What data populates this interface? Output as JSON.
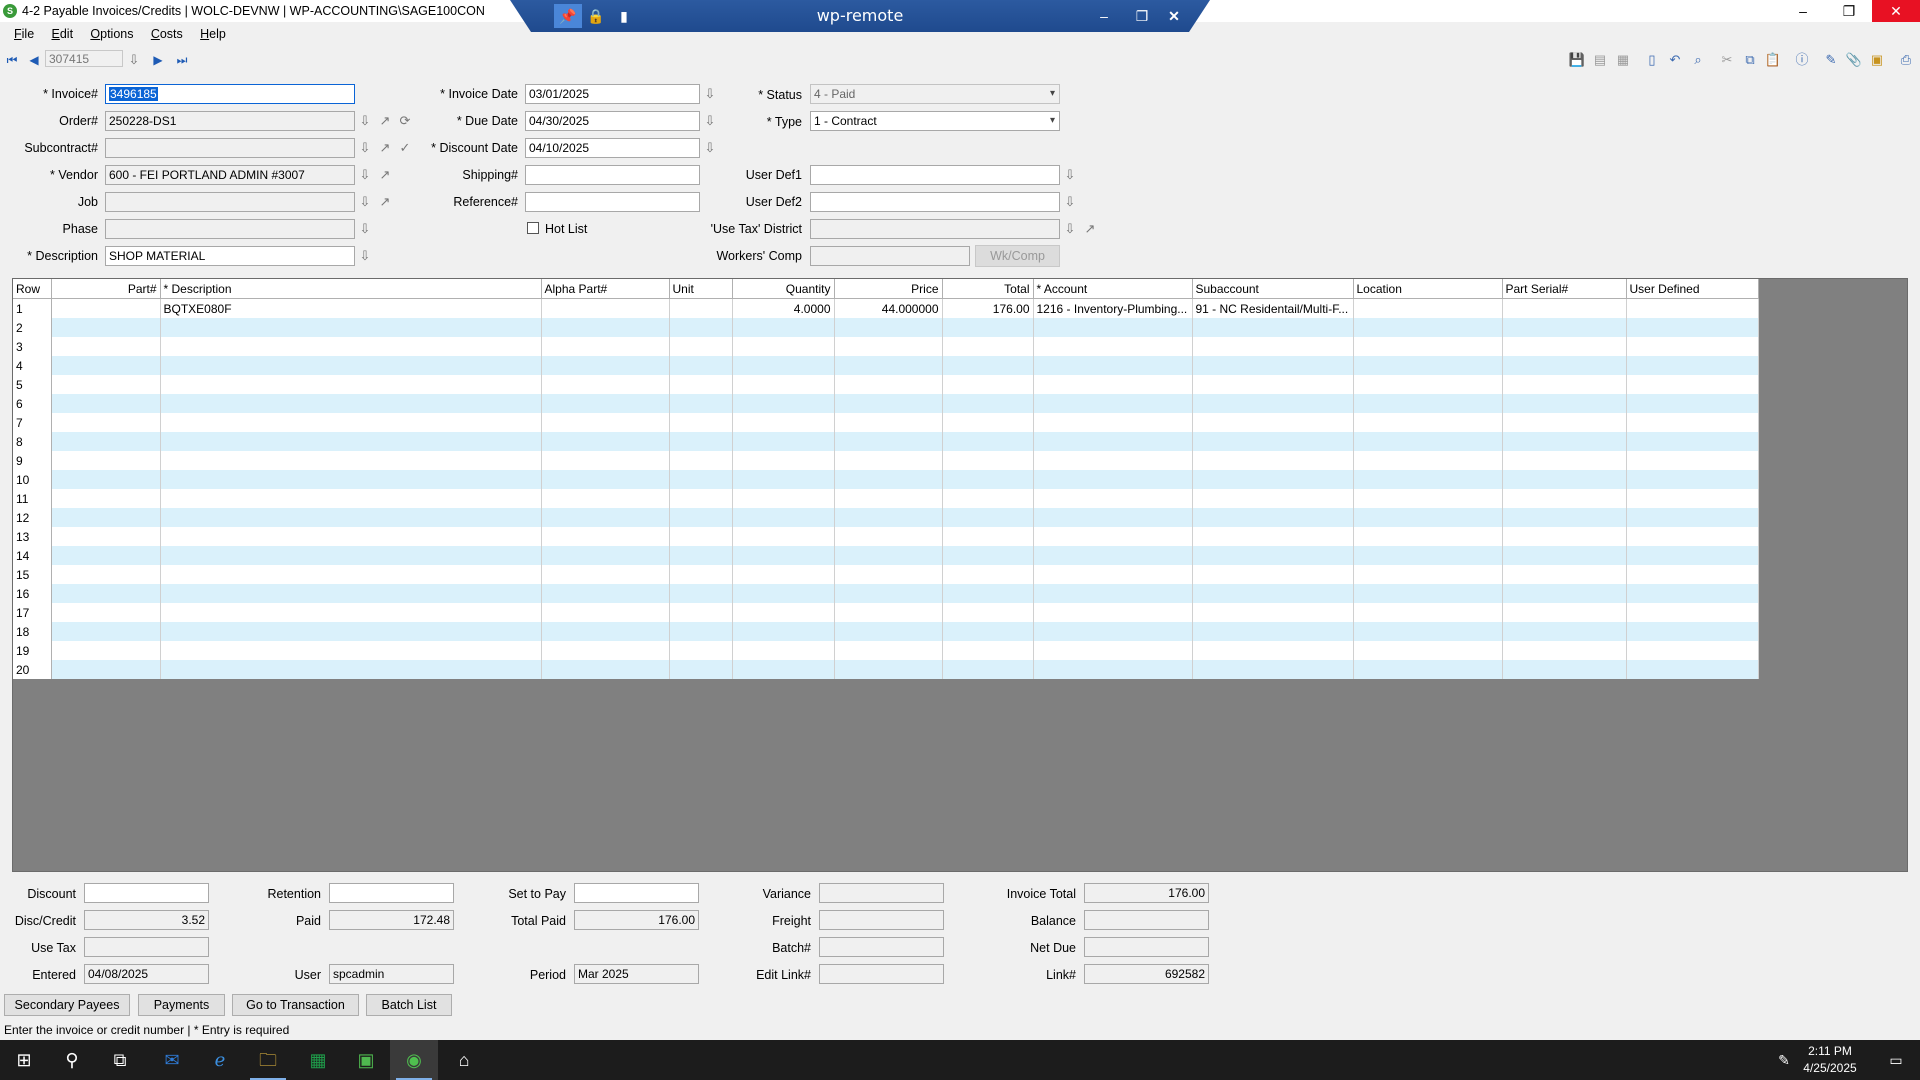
{
  "window": {
    "title": "4-2 Payable Invoices/Credits  |  WOLC-DEVNW  |  WP-ACCOUNTING\\SAGE100CON",
    "minimize": "–",
    "restore": "❐",
    "close": "✕"
  },
  "remote": {
    "title": "wp-remote",
    "min": "–",
    "restore": "❐",
    "close": "✕"
  },
  "menu": [
    {
      "u": "F",
      "rest": "ile"
    },
    {
      "u": "E",
      "rest": "dit"
    },
    {
      "u": "O",
      "rest": "ptions"
    },
    {
      "u": "C",
      "rest": "osts"
    },
    {
      "u": "H",
      "rest": "elp"
    }
  ],
  "nav": {
    "record": "307415"
  },
  "form": {
    "invoice_label": "* Invoice#",
    "invoice": "3496185",
    "order_label": "Order#",
    "order": "250228-DS1",
    "subcontract_label": "Subcontract#",
    "subcontract": "",
    "vendor_label": "* Vendor",
    "vendor": "600 - FEI PORTLAND ADMIN #3007",
    "job_label": "Job",
    "job": "",
    "phase_label": "Phase",
    "phase": "",
    "description_label": "* Description",
    "description": "SHOP MATERIAL",
    "invoice_date_label": "* Invoice Date",
    "invoice_date": "03/01/2025",
    "due_date_label": "* Due Date",
    "due_date": "04/30/2025",
    "discount_date_label": "* Discount Date",
    "discount_date": "04/10/2025",
    "shipping_label": "Shipping#",
    "shipping": "",
    "reference_label": "Reference#",
    "reference": "",
    "hotlist_label": "Hot List",
    "status_label": "* Status",
    "status": "4 - Paid",
    "type_label": "* Type",
    "type": "1 - Contract",
    "userdef1_label": "User Def1",
    "userdef1": "",
    "userdef2_label": "User Def2",
    "userdef2": "",
    "usetax_district_label": "'Use Tax' District",
    "usetax_district": "",
    "workers_comp_label": "Workers' Comp",
    "workers_comp": "",
    "wkcomp_button": "Wk/Comp"
  },
  "grid": {
    "columns": [
      "Row",
      "Part#",
      "* Description",
      "Alpha Part#",
      "Unit",
      "Quantity",
      "Price",
      "Total",
      "* Account",
      "Subaccount",
      "Location",
      "Part Serial#",
      "User Defined"
    ],
    "rows": [
      [
        "1",
        "",
        "BQTXE080F",
        "",
        "",
        "4.0000",
        "44.000000",
        "176.00",
        "1216 - Inventory-Plumbing...",
        "91 - NC Residentail/Multi-F...",
        "",
        "",
        ""
      ],
      [
        "2",
        "",
        "",
        "",
        "",
        "",
        "",
        "",
        "",
        "",
        "",
        "",
        ""
      ],
      [
        "3",
        "",
        "",
        "",
        "",
        "",
        "",
        "",
        "",
        "",
        "",
        "",
        ""
      ],
      [
        "4",
        "",
        "",
        "",
        "",
        "",
        "",
        "",
        "",
        "",
        "",
        "",
        ""
      ],
      [
        "5",
        "",
        "",
        "",
        "",
        "",
        "",
        "",
        "",
        "",
        "",
        "",
        ""
      ],
      [
        "6",
        "",
        "",
        "",
        "",
        "",
        "",
        "",
        "",
        "",
        "",
        "",
        ""
      ],
      [
        "7",
        "",
        "",
        "",
        "",
        "",
        "",
        "",
        "",
        "",
        "",
        "",
        ""
      ],
      [
        "8",
        "",
        "",
        "",
        "",
        "",
        "",
        "",
        "",
        "",
        "",
        "",
        ""
      ],
      [
        "9",
        "",
        "",
        "",
        "",
        "",
        "",
        "",
        "",
        "",
        "",
        "",
        ""
      ],
      [
        "10",
        "",
        "",
        "",
        "",
        "",
        "",
        "",
        "",
        "",
        "",
        "",
        ""
      ],
      [
        "11",
        "",
        "",
        "",
        "",
        "",
        "",
        "",
        "",
        "",
        "",
        "",
        ""
      ],
      [
        "12",
        "",
        "",
        "",
        "",
        "",
        "",
        "",
        "",
        "",
        "",
        "",
        ""
      ],
      [
        "13",
        "",
        "",
        "",
        "",
        "",
        "",
        "",
        "",
        "",
        "",
        "",
        ""
      ],
      [
        "14",
        "",
        "",
        "",
        "",
        "",
        "",
        "",
        "",
        "",
        "",
        "",
        ""
      ],
      [
        "15",
        "",
        "",
        "",
        "",
        "",
        "",
        "",
        "",
        "",
        "",
        "",
        ""
      ],
      [
        "16",
        "",
        "",
        "",
        "",
        "",
        "",
        "",
        "",
        "",
        "",
        "",
        ""
      ],
      [
        "17",
        "",
        "",
        "",
        "",
        "",
        "",
        "",
        "",
        "",
        "",
        "",
        ""
      ],
      [
        "18",
        "",
        "",
        "",
        "",
        "",
        "",
        "",
        "",
        "",
        "",
        "",
        ""
      ],
      [
        "19",
        "",
        "",
        "",
        "",
        "",
        "",
        "",
        "",
        "",
        "",
        "",
        ""
      ],
      [
        "20",
        "",
        "",
        "",
        "",
        "",
        "",
        "",
        "",
        "",
        "",
        "",
        ""
      ]
    ]
  },
  "totals": {
    "discount_label": "Discount",
    "discount": "",
    "disc_credit_label": "Disc/Credit",
    "disc_credit": "3.52",
    "use_tax_label": "Use Tax",
    "use_tax": "",
    "entered_label": "Entered",
    "entered": "04/08/2025",
    "retention_label": "Retention",
    "retention": "",
    "paid_label": "Paid",
    "paid": "172.48",
    "user_label": "User",
    "user": "spcadmin",
    "set_to_pay_label": "Set to Pay",
    "set_to_pay": "",
    "total_paid_label": "Total Paid",
    "total_paid": "176.00",
    "period_label": "Period",
    "period": "Mar 2025",
    "variance_label": "Variance",
    "variance": "",
    "freight_label": "Freight",
    "freight": "",
    "batch_label": "Batch#",
    "batch": "",
    "edit_link_label": "Edit Link#",
    "edit_link": "",
    "invoice_total_label": "Invoice Total",
    "invoice_total": "176.00",
    "balance_label": "Balance",
    "balance": "",
    "net_due_label": "Net Due",
    "net_due": "",
    "link_label": "Link#",
    "link": "692582"
  },
  "buttons": {
    "secondary_payees": "Secondary Payees",
    "payments": "Payments",
    "go_to_transaction": "Go to Transaction",
    "batch_list": "Batch List"
  },
  "status": {
    "text": "Enter the invoice or credit number  |  * Entry is required"
  },
  "taskbar": {
    "time": "2:11 PM",
    "date": "4/25/2025"
  }
}
